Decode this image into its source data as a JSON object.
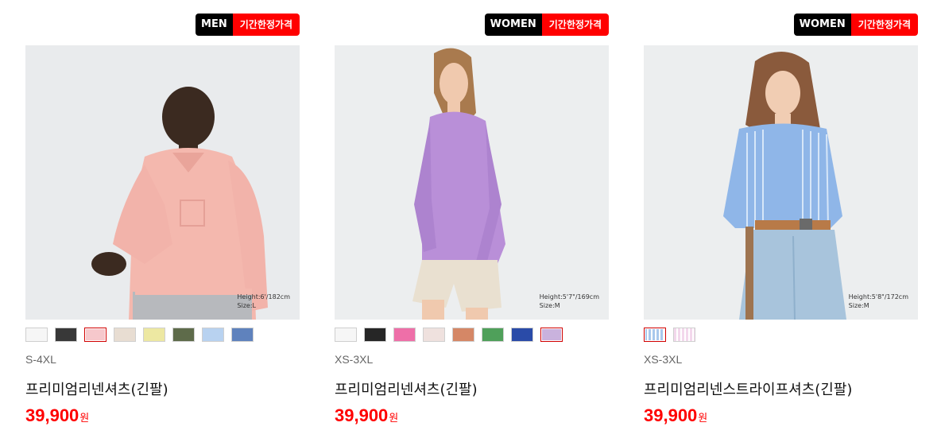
{
  "products": [
    {
      "gender_badge": "MEN",
      "sale_badge": "기간한정가격",
      "image": "man-in-pink-linen-shirt",
      "model_height": "Height:6'/182cm",
      "model_size": "Size:L",
      "swatches": [
        {
          "color": "#f6f6f6",
          "selected": false
        },
        {
          "color": "#383838",
          "selected": false
        },
        {
          "color": "#f6c8cc",
          "selected": true
        },
        {
          "color": "#e8ddd2",
          "selected": false
        },
        {
          "color": "#ede8a2",
          "selected": false
        },
        {
          "color": "#5e6b4a",
          "selected": false
        },
        {
          "color": "#b8d2f0",
          "selected": false
        },
        {
          "color": "#5f82bd",
          "selected": false
        }
      ],
      "size_range": "S-4XL",
      "name": "프리미엄리넨셔츠(긴팔)",
      "price": "39,900",
      "currency": "원"
    },
    {
      "gender_badge": "WOMEN",
      "sale_badge": "기간한정가격",
      "image": "woman-in-purple-linen-shirt",
      "model_height": "Height:5'7\"/169cm",
      "model_size": "Size:M",
      "swatches": [
        {
          "color": "#f6f6f6",
          "selected": false
        },
        {
          "color": "#262626",
          "selected": false
        },
        {
          "color": "#ee6fa8",
          "selected": false
        },
        {
          "color": "#efe1de",
          "selected": false
        },
        {
          "color": "#d58766",
          "selected": false
        },
        {
          "color": "#4fa05a",
          "selected": false
        },
        {
          "color": "#2a4ba8",
          "selected": false
        },
        {
          "color": "#c9b2dd",
          "selected": true
        }
      ],
      "size_range": "XS-3XL",
      "name": "프리미엄리넨셔츠(긴팔)",
      "price": "39,900",
      "currency": "원"
    },
    {
      "gender_badge": "WOMEN",
      "sale_badge": "기간한정가격",
      "image": "woman-in-blue-stripe-linen-shirt",
      "model_height": "Height:5'8\"/172cm",
      "model_size": "Size:M",
      "swatches": [
        {
          "color": "#a9c8ec",
          "selected": true,
          "stripe": "#ffffff"
        },
        {
          "color": "#f3d8ec",
          "selected": false,
          "stripe": "#ffffff"
        }
      ],
      "size_range": "XS-3XL",
      "name": "프리미엄리넨스트라이프셔츠(긴팔)",
      "price": "39,900",
      "currency": "원"
    }
  ],
  "colors": {
    "sale_red": "#ff0000",
    "badge_black": "#000000",
    "price_red": "#ff0000"
  }
}
